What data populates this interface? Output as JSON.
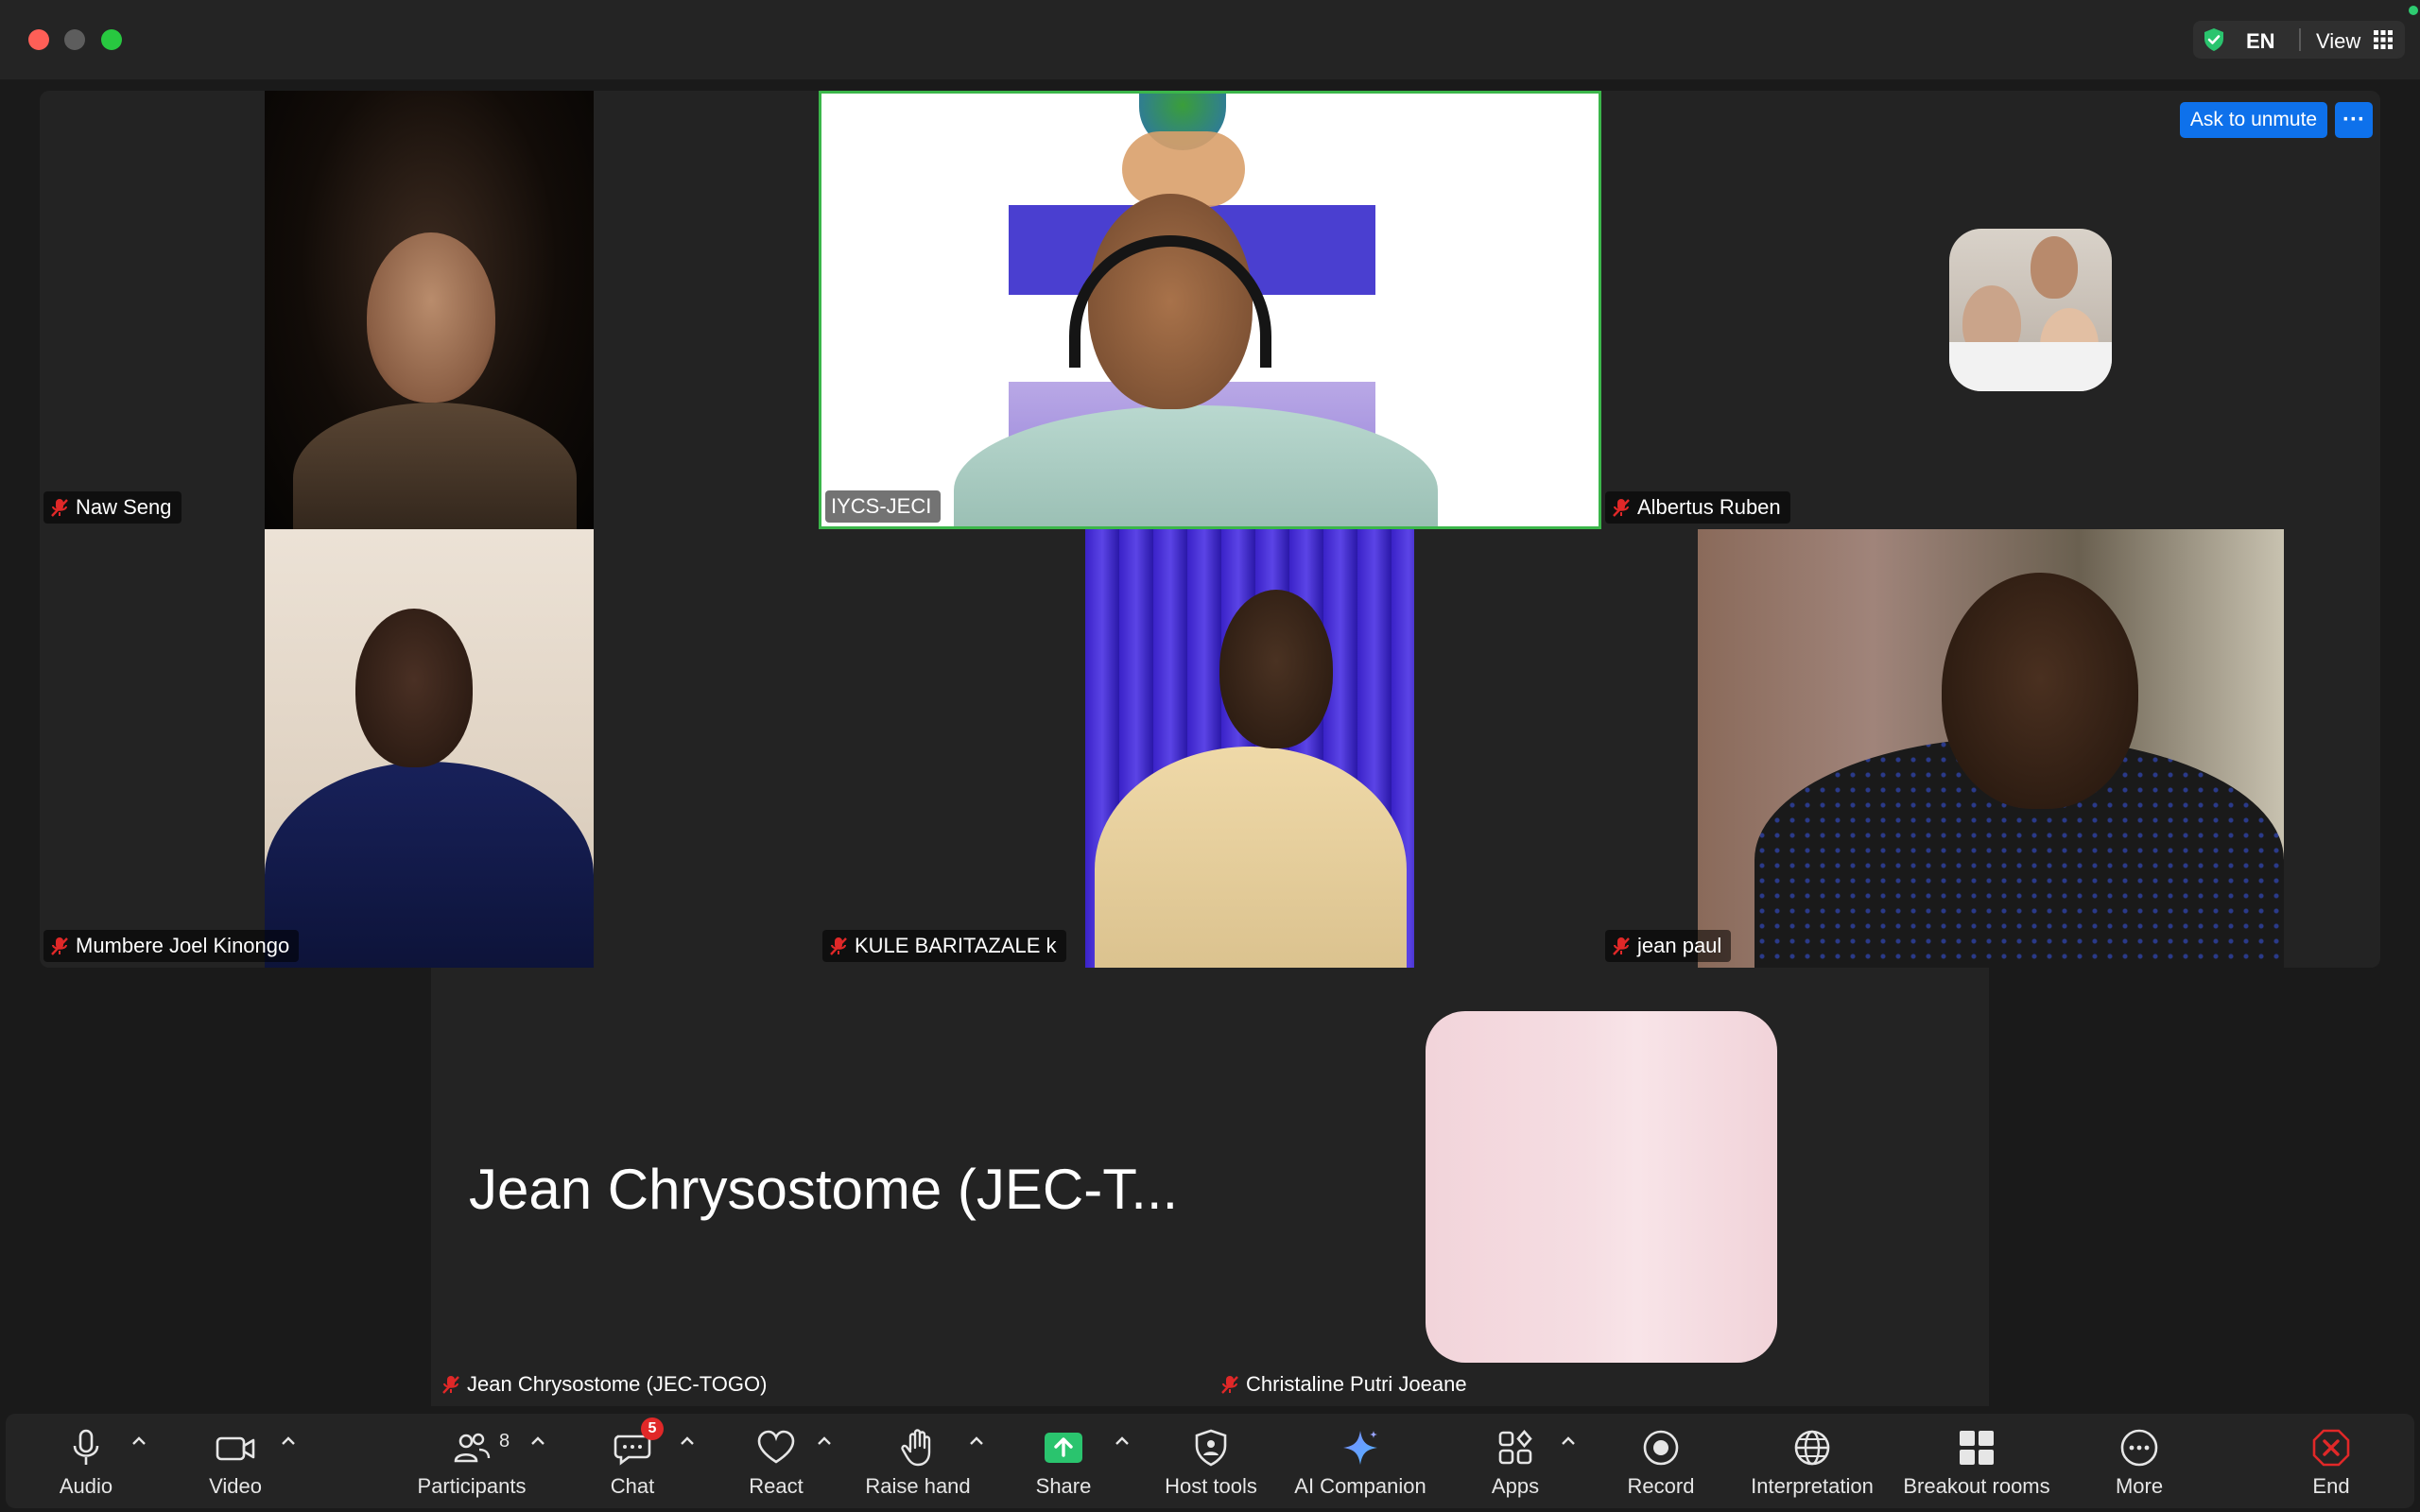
{
  "titlebar": {
    "language": "EN",
    "view_label": "View"
  },
  "icons": {
    "shield": "shield-check-icon",
    "grid": "grid-view-icon",
    "mute": "muted-mic-icon"
  },
  "colors": {
    "accent_blue": "#0e71eb",
    "active_speaker_border": "#3bb64a",
    "mute_red": "#e02828",
    "share_green": "#2ac46e",
    "end_red": "#e02828"
  },
  "tile_actions": {
    "ask_to_unmute": "Ask to unmute",
    "more": "···"
  },
  "participants": [
    {
      "name": "Naw Seng",
      "muted": true
    },
    {
      "name": "IYCS-JECI",
      "muted": false,
      "active_speaker": true
    },
    {
      "name": "Albertus Ruben",
      "muted": true
    },
    {
      "name": "Mumbere Joel Kinongo",
      "muted": true
    },
    {
      "name": "KULE BARITAZALE k",
      "muted": true
    },
    {
      "name": "jean paul",
      "muted": true
    },
    {
      "name": "Jean Chrysostome (JEC-TOGO)",
      "muted": true,
      "display_name": "Jean Chrysostome (JEC-T..."
    },
    {
      "name": "Christaline Putri Joeane",
      "muted": true
    }
  ],
  "toolbar": {
    "audio": "Audio",
    "video": "Video",
    "participants": "Participants",
    "participant_count": "8",
    "chat": "Chat",
    "chat_badge": "5",
    "react": "React",
    "raise_hand": "Raise hand",
    "share": "Share",
    "host_tools": "Host tools",
    "ai_companion": "AI Companion",
    "apps": "Apps",
    "record": "Record",
    "interpretation": "Interpretation",
    "breakout_rooms": "Breakout rooms",
    "more": "More",
    "end": "End"
  }
}
